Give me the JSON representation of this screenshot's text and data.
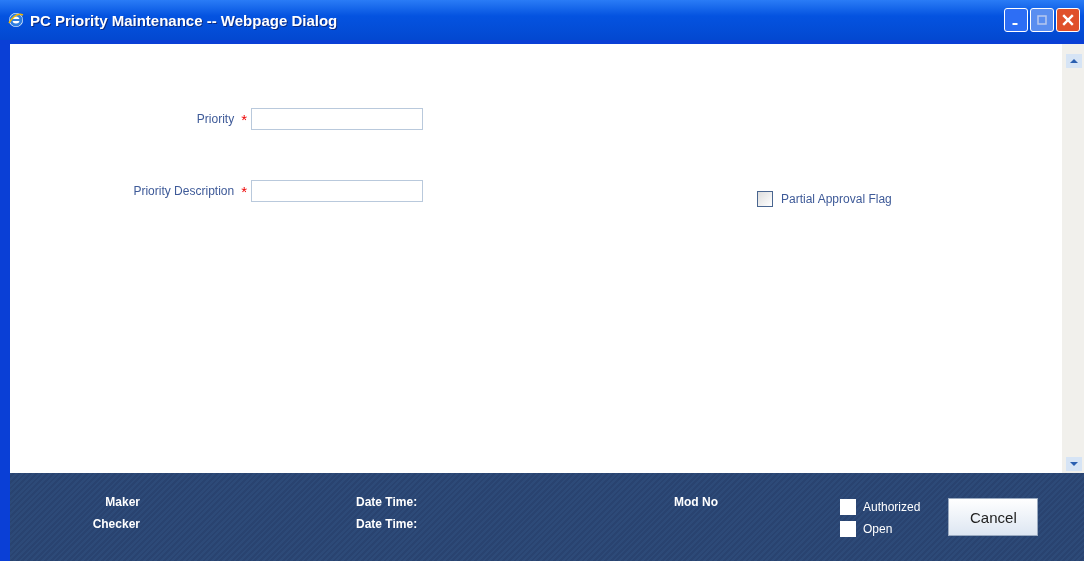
{
  "window": {
    "title": "PC Priority Maintenance -- Webpage Dialog"
  },
  "fields": [
    {
      "label": "Priority",
      "required_mark": "*"
    },
    {
      "label": "Priority Description",
      "required_mark": "*"
    }
  ],
  "partial_approval": {
    "label": "Partial Approval Flag",
    "checked": false
  },
  "footer": {
    "maker": "Maker",
    "checker": "Checker",
    "date_time_1": "Date Time:",
    "date_time_2": "Date Time:",
    "mod_no": "Mod No",
    "checks": [
      {
        "label": "Authorized",
        "checked": false
      },
      {
        "label": "Open",
        "checked": false
      }
    ],
    "cancel": "Cancel"
  }
}
